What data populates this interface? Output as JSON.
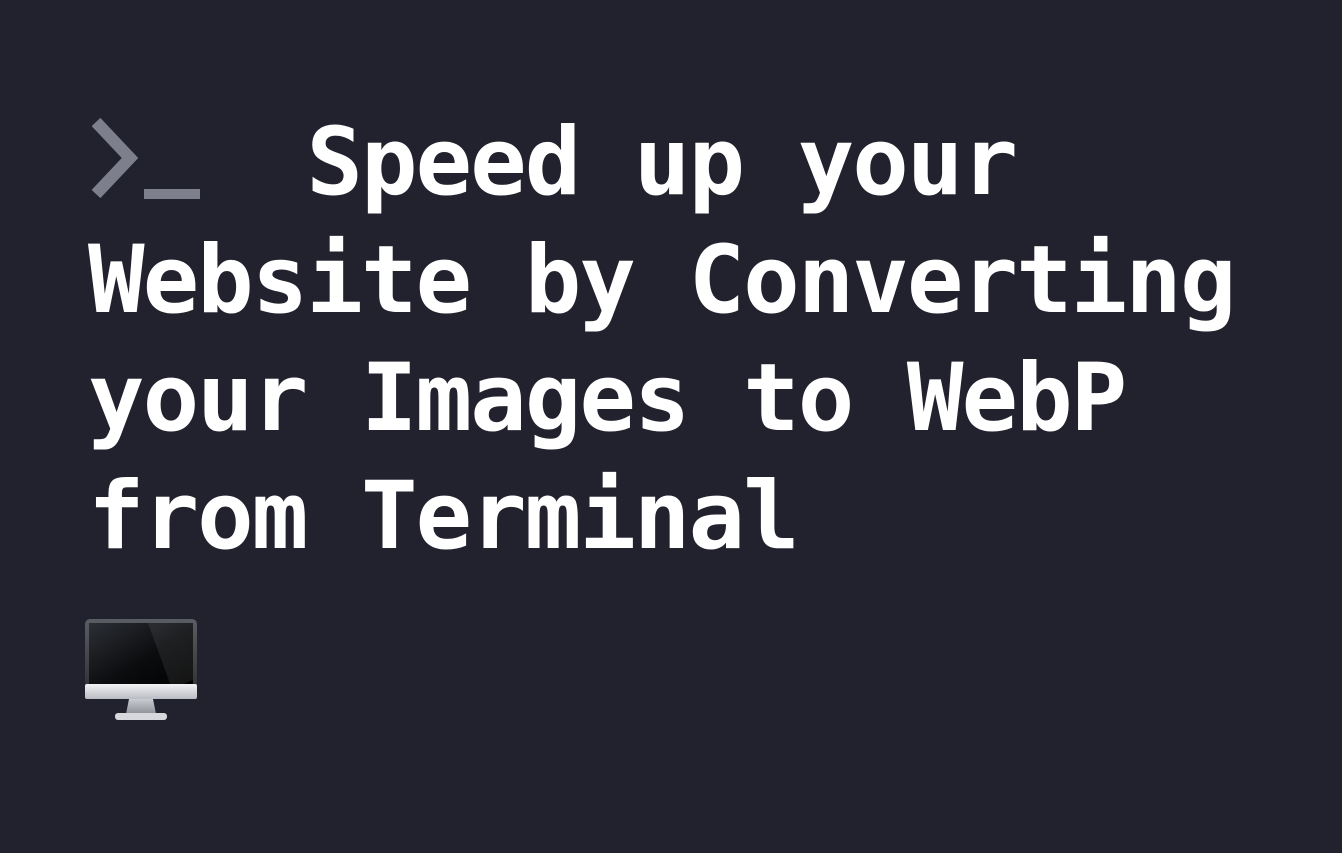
{
  "card": {
    "title_lines": [
      "    Speed up your",
      "Website by Converting",
      "your Images to WebP",
      "from Terminal"
    ],
    "prompt_icon": "terminal-prompt-icon",
    "monitor_icon": "desktop-computer-icon"
  },
  "colors": {
    "background": "#21222e",
    "text": "#ffffff",
    "prompt": "#7d808c"
  }
}
